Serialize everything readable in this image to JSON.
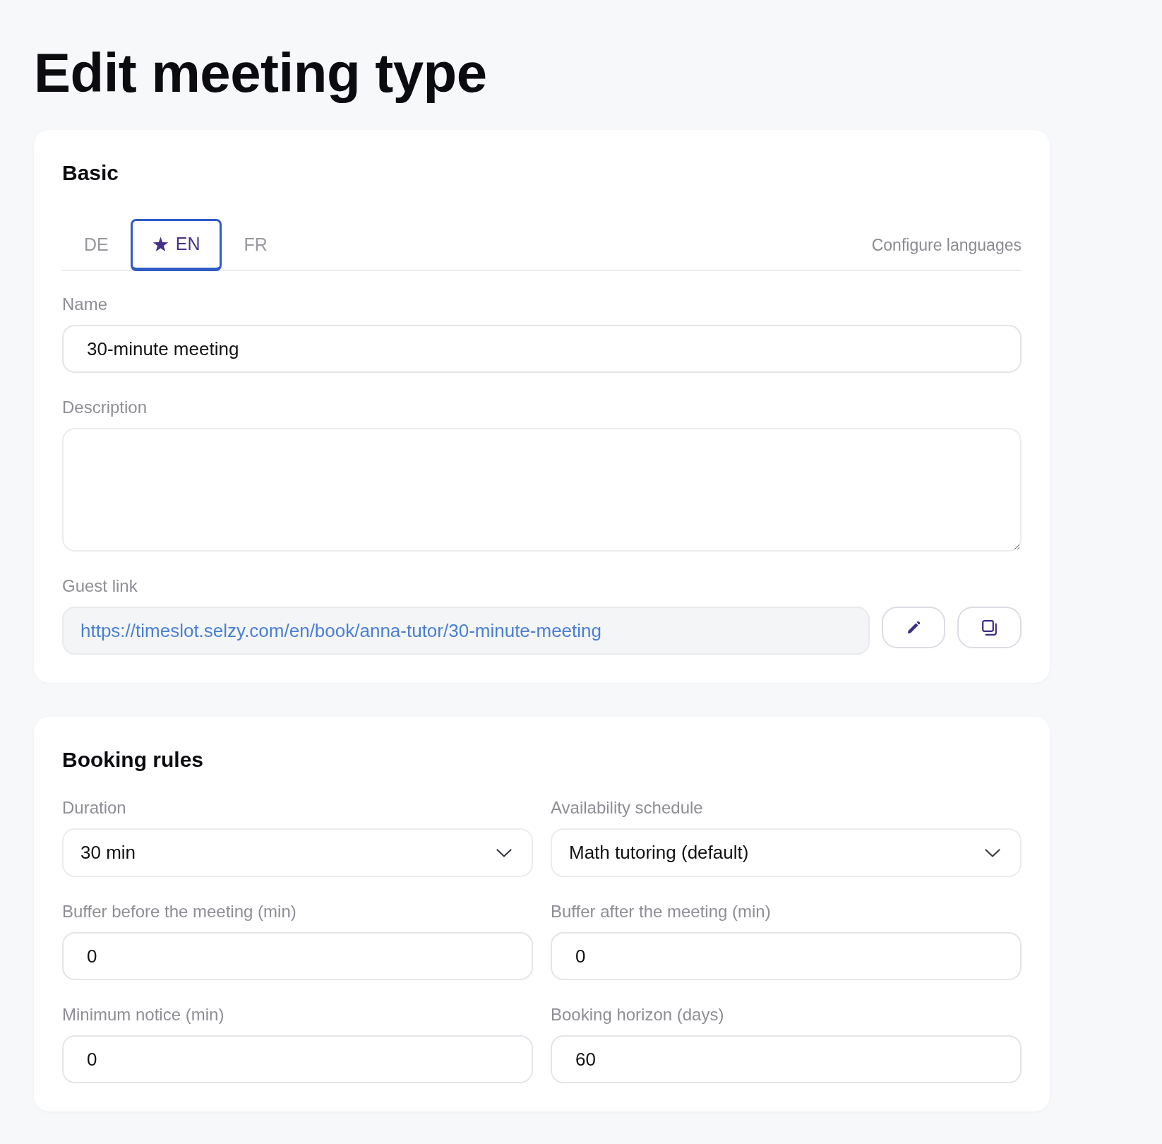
{
  "page": {
    "title": "Edit meeting type"
  },
  "basic": {
    "title": "Basic",
    "language_tabs": [
      {
        "label": "DE",
        "selected": false,
        "default": false
      },
      {
        "label": "EN",
        "selected": true,
        "default": true
      },
      {
        "label": "FR",
        "selected": false,
        "default": false
      }
    ],
    "configure_languages": "Configure languages",
    "fields": [
      {
        "kind": "text",
        "label": "Name",
        "value": "30-minute meeting"
      },
      {
        "kind": "textarea",
        "label": "Description"
      },
      {
        "kind": "link",
        "label": "Guest link",
        "value": "https://timeslot.selzy.com/en/book/anna-tutor/30-minute-meeting"
      }
    ]
  },
  "booking_rules": {
    "title": "Booking rules",
    "fields": [
      {
        "kind": "select",
        "label": "Duration",
        "value": "30 min"
      },
      {
        "kind": "select",
        "label": "Availability schedule",
        "value": "Math tutoring (default)"
      },
      {
        "kind": "number",
        "label": "Buffer before the meeting (min)",
        "value": "0"
      },
      {
        "kind": "number",
        "label": "Buffer after the meeting (min)",
        "value": "0"
      },
      {
        "kind": "number",
        "label": "Minimum notice (min)",
        "value": "0"
      },
      {
        "kind": "number",
        "label": "Booking horizon (days)",
        "value": "60"
      }
    ]
  }
}
